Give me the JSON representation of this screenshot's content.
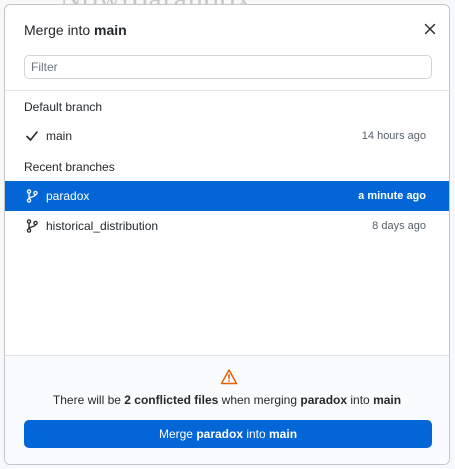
{
  "background": {
    "ghost_text": "Nowroaraudox"
  },
  "dialog": {
    "title_prefix": "Merge into",
    "title_branch": "main",
    "close_icon": "close-icon",
    "filter_placeholder": "Filter",
    "filter_value": ""
  },
  "groups": {
    "default_branch": {
      "header": "Default branch",
      "items": [
        {
          "name": "main",
          "time": "14 hours ago",
          "icon": "check-icon",
          "selected": false
        }
      ]
    },
    "recent_branches": {
      "header": "Recent branches",
      "items": [
        {
          "name": "paradox",
          "time": "a minute ago",
          "icon": "git-branch-icon",
          "selected": true
        },
        {
          "name": "historical_distribution",
          "time": "8 days ago",
          "icon": "git-branch-icon",
          "selected": false
        }
      ]
    }
  },
  "footer": {
    "warning_icon": "alert-triangle-icon",
    "warning": {
      "part1": "There will be ",
      "conflicts": "2 conflicted files",
      "part2": " when merging ",
      "source": "paradox",
      "part3": " into ",
      "target": "main"
    },
    "button": {
      "prefix": "Merge ",
      "source": "paradox",
      "middle": " into ",
      "target": "main"
    }
  },
  "colors": {
    "accent": "#0366d6",
    "warning": "#e36209",
    "text": "#24292e",
    "muted": "#586069"
  }
}
